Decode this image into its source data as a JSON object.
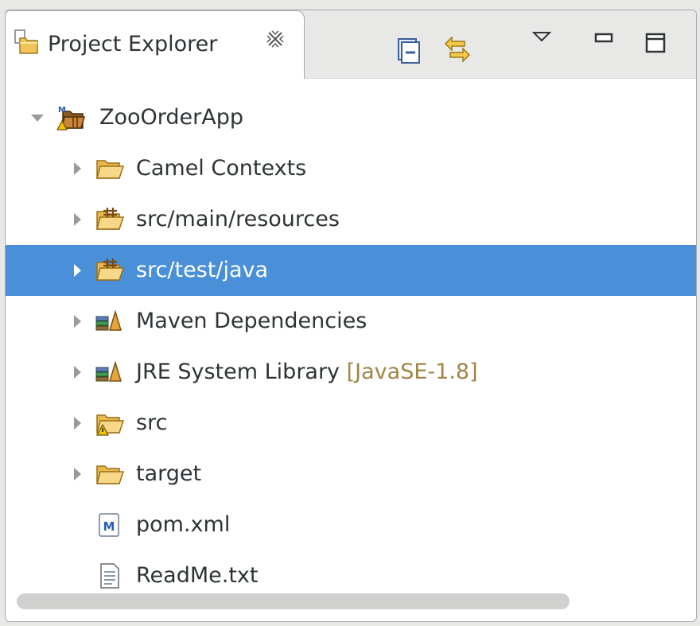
{
  "view": {
    "tab_title": "Project Explorer",
    "tab_icon": "project-explorer-icon",
    "close_icon": "close-tab-icon",
    "toolbar": [
      {
        "name": "collapse-all-button",
        "icon": "collapse-all-icon"
      },
      {
        "name": "link-with-editor-button",
        "icon": "link-with-editor-icon"
      },
      {
        "name": "view-menu-button",
        "icon": "chevron-down-icon"
      },
      {
        "name": "minimize-button",
        "icon": "minimize-icon"
      },
      {
        "name": "maximize-button",
        "icon": "maximize-icon"
      }
    ]
  },
  "tree": [
    {
      "label": "ZooOrderApp",
      "decoration": "",
      "icon": "maven-project-icon",
      "expander": "expanded",
      "depth": 0,
      "selected": false
    },
    {
      "label": "Camel Contexts",
      "decoration": "",
      "icon": "folder-icon",
      "expander": "collapsed",
      "depth": 1,
      "selected": false
    },
    {
      "label": "src/main/resources",
      "decoration": "",
      "icon": "source-folder-icon",
      "expander": "collapsed",
      "depth": 1,
      "selected": false
    },
    {
      "label": "src/test/java",
      "decoration": "",
      "icon": "source-folder-icon",
      "expander": "collapsed",
      "depth": 1,
      "selected": true
    },
    {
      "label": "Maven Dependencies",
      "decoration": "",
      "icon": "library-icon",
      "expander": "collapsed",
      "depth": 1,
      "selected": false
    },
    {
      "label": "JRE System Library",
      "decoration": "[JavaSE-1.8]",
      "icon": "library-icon",
      "expander": "collapsed",
      "depth": 1,
      "selected": false
    },
    {
      "label": "src",
      "decoration": "",
      "icon": "folder-warning-icon",
      "expander": "collapsed",
      "depth": 1,
      "selected": false
    },
    {
      "label": "target",
      "decoration": "",
      "icon": "folder-icon",
      "expander": "collapsed",
      "depth": 1,
      "selected": false
    },
    {
      "label": "pom.xml",
      "decoration": "",
      "icon": "maven-pom-file-icon",
      "expander": "none",
      "depth": 1,
      "selected": false
    },
    {
      "label": "ReadMe.txt",
      "decoration": "",
      "icon": "text-file-icon",
      "expander": "none",
      "depth": 1,
      "selected": false
    }
  ],
  "colors": {
    "selection": "#4a90d9",
    "decoration_text": "#a08545",
    "panel_background": "#e8e8e7"
  }
}
